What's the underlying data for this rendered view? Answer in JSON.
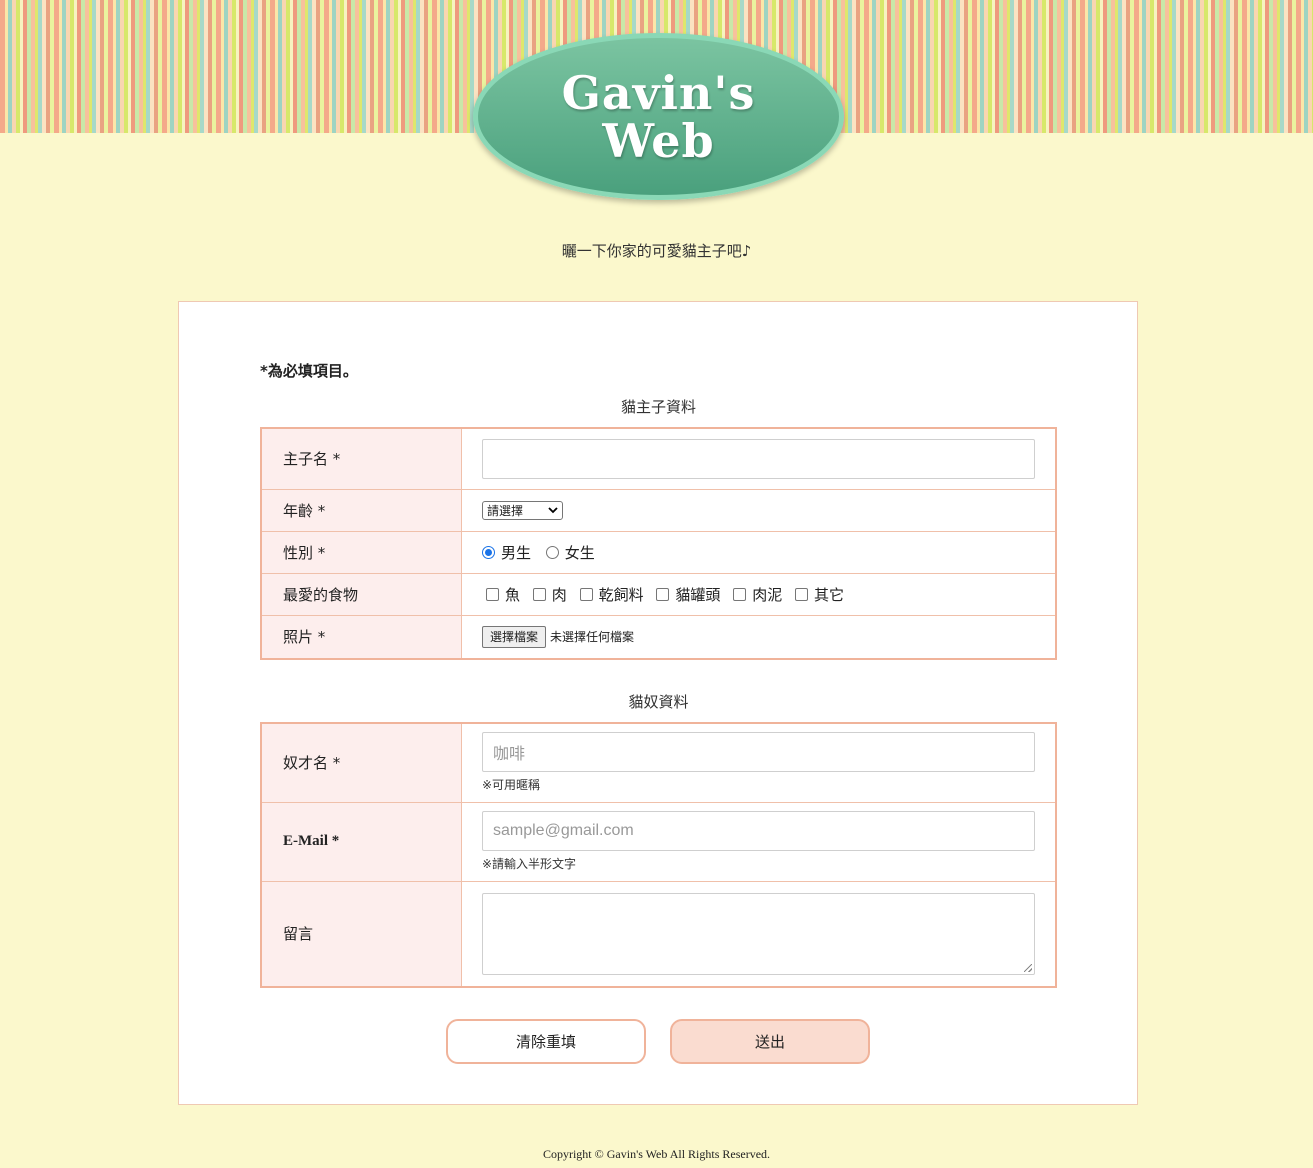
{
  "header": {
    "logo_line1": "Gavin's",
    "logo_line2": "Web",
    "tagline": "曬一下你家的可愛貓主子吧♪"
  },
  "form": {
    "required_note": "*為必填項目。",
    "section1_caption": "貓主子資料",
    "cat_name_label": "主子名 *",
    "cat_name_value": "",
    "age_label": "年齡 *",
    "age_selected": "請選擇",
    "gender_label": "性別 *",
    "gender_options": [
      "男生",
      "女生"
    ],
    "gender_selected": "男生",
    "food_label": "最愛的食物",
    "food_options": [
      "魚",
      "肉",
      "乾飼料",
      "貓罐頭",
      "肉泥",
      "其它"
    ],
    "photo_label": "照片 *",
    "photo_button": "選擇檔案",
    "photo_status": "未選擇任何檔案",
    "section2_caption": "貓奴資料",
    "owner_name_label": "奴才名 *",
    "owner_name_placeholder": "咖啡",
    "owner_name_hint": "※可用暱稱",
    "email_label": "E-Mail *",
    "email_placeholder": "sample@gmail.com",
    "email_hint": "※請輸入半形文字",
    "message_label": "留言",
    "reset_label": "清除重填",
    "submit_label": "送出"
  },
  "footer": {
    "copyright": "Copyright © Gavin's Web All Rights Reserved."
  },
  "colors": {
    "page_bg": "#fbf8cc",
    "logo_green": "#4aa07d",
    "label_bg": "#fdeeed",
    "border_salmon": "#f0b39a",
    "submit_bg": "#fadcd0"
  }
}
